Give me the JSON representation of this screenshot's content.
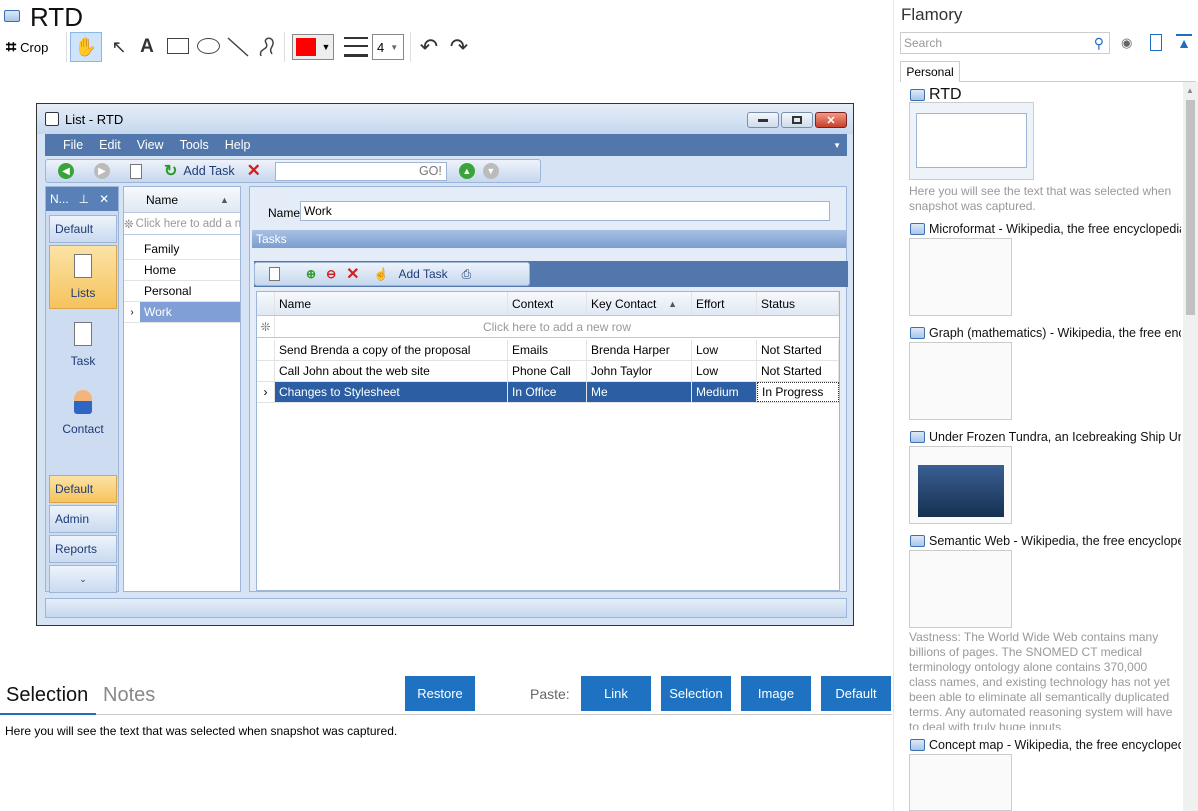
{
  "app": {
    "title": "RTD"
  },
  "toolbar": {
    "crop_label": "Crop",
    "line_width": "4",
    "color": "#ff0000"
  },
  "window": {
    "title": "List - RTD",
    "menu": [
      "File",
      "Edit",
      "View",
      "Tools",
      "Help"
    ],
    "toolbar": {
      "add_task": "Add Task",
      "go": "GO!"
    },
    "nav": {
      "header": "N...",
      "default_top": "Default",
      "lists": "Lists",
      "task": "Task",
      "contact": "Contact",
      "default_bottom": "Default",
      "admin": "Admin",
      "reports": "Reports"
    },
    "lists": {
      "header": "Name",
      "placeholder": "Click here to add a new",
      "rows": [
        "Family",
        "Home",
        "Personal",
        "Work"
      ]
    },
    "detail": {
      "name_label": "Name",
      "name_value": "Work",
      "tasks_label": "Tasks",
      "add_task": "Add Task"
    },
    "tasks": {
      "columns": [
        "Name",
        "Context",
        "Key Contact",
        "Effort",
        "Status"
      ],
      "placeholder": "Click here to add a new row",
      "rows": [
        [
          "Send Brenda a copy of the proposal",
          "Emails",
          "Brenda Harper",
          "Low",
          "Not Started"
        ],
        [
          "Call John about the web site",
          "Phone Call",
          "John Taylor",
          "Low",
          "Not Started"
        ],
        [
          "Changes to Stylesheet",
          "In Office",
          "Me",
          "Medium",
          "In Progress"
        ]
      ]
    }
  },
  "bottom": {
    "tabs": [
      "Selection",
      "Notes"
    ],
    "restore": "Restore",
    "paste_label": "Paste:",
    "paste_buttons": [
      "Link",
      "Selection",
      "Image",
      "Default"
    ],
    "selection_text": "Here you will see the text that was selected when snapshot was captured."
  },
  "sidebar": {
    "title": "Flamory",
    "search_placeholder": "Search",
    "tab": "Personal",
    "items": [
      {
        "title": "RTD",
        "desc": "Here you will see the text that was selected when snapshot was captured."
      },
      {
        "title": "Microformat - Wikipedia, the free encyclopedia"
      },
      {
        "title": "Graph (mathematics) - Wikipedia, the free encyclopedia"
      },
      {
        "title": "Under Frozen Tundra, an Icebreaking Ship Uncovers"
      },
      {
        "title": "Semantic Web - Wikipedia, the free encyclopedia",
        "desc": "Vastness: The World Wide Web contains many billions of pages. The SNOMED CT medical terminology ontology alone contains 370,000 class names, and existing technology has not yet been able to eliminate all semantically duplicated terms. Any automated reasoning system will have to deal with truly huge inputs."
      },
      {
        "title": "Concept map - Wikipedia, the free encyclopedia"
      }
    ]
  }
}
